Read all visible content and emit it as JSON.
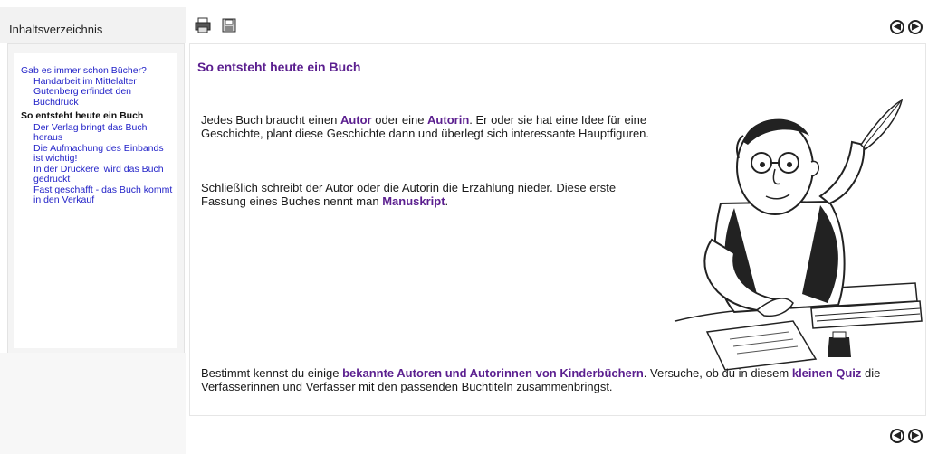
{
  "sidebar": {
    "title": "Inhaltsverzeichnis",
    "items": [
      {
        "label": "Gab es immer schon Bücher?",
        "level": 1,
        "current": false
      },
      {
        "label": "Handarbeit im Mittelalter",
        "level": 2,
        "current": false
      },
      {
        "label": "Gutenberg erfindet den Buchdruck",
        "level": 2,
        "current": false
      },
      {
        "label": "So entsteht heute ein Buch",
        "level": 1,
        "current": true
      },
      {
        "label": "Der Verlag bringt das Buch heraus",
        "level": 2,
        "current": false
      },
      {
        "label": "Die Aufmachung des Einbands ist wichtig!",
        "level": 2,
        "current": false
      },
      {
        "label": "In der Druckerei wird das Buch gedruckt",
        "level": 2,
        "current": false
      },
      {
        "label": "Fast geschafft - das Buch kommt in den Verkauf",
        "level": 2,
        "current": false
      }
    ]
  },
  "toolbar": {
    "icons": [
      "printer-icon",
      "save-icon"
    ]
  },
  "nav": {
    "prev_icon": "arrow-left-circle-icon",
    "next_icon": "arrow-right-circle-icon"
  },
  "content": {
    "title": "So entsteht heute ein Buch",
    "p1": {
      "t1": "Jedes Buch braucht einen ",
      "k1": "Autor",
      "t2": " oder eine ",
      "k2": "Autorin",
      "t3": ". Er oder sie hat eine Idee für eine Geschichte, plant diese Geschichte dann und überlegt sich interessante Hauptfiguren."
    },
    "p2": {
      "t1": "Schließlich schreibt der Autor oder die Autorin die Erzählung nieder. Diese erste Fassung eines Buches nennt man ",
      "k1": "Manuskript",
      "t2": "."
    },
    "p3": {
      "t1": "Bestimmt kennst du einige ",
      "link1": "bekannte Autoren und Autorinnen von Kinderbüchern",
      "t2": ". Versuche, ob du in diesem ",
      "link2": "kleinen Quiz",
      "t3": " die Verfasserinnen und Verfasser mit den passenden Buchtiteln zusammenbringst."
    }
  },
  "colors": {
    "accent": "#5b1f8f",
    "link": "#2323c8"
  }
}
